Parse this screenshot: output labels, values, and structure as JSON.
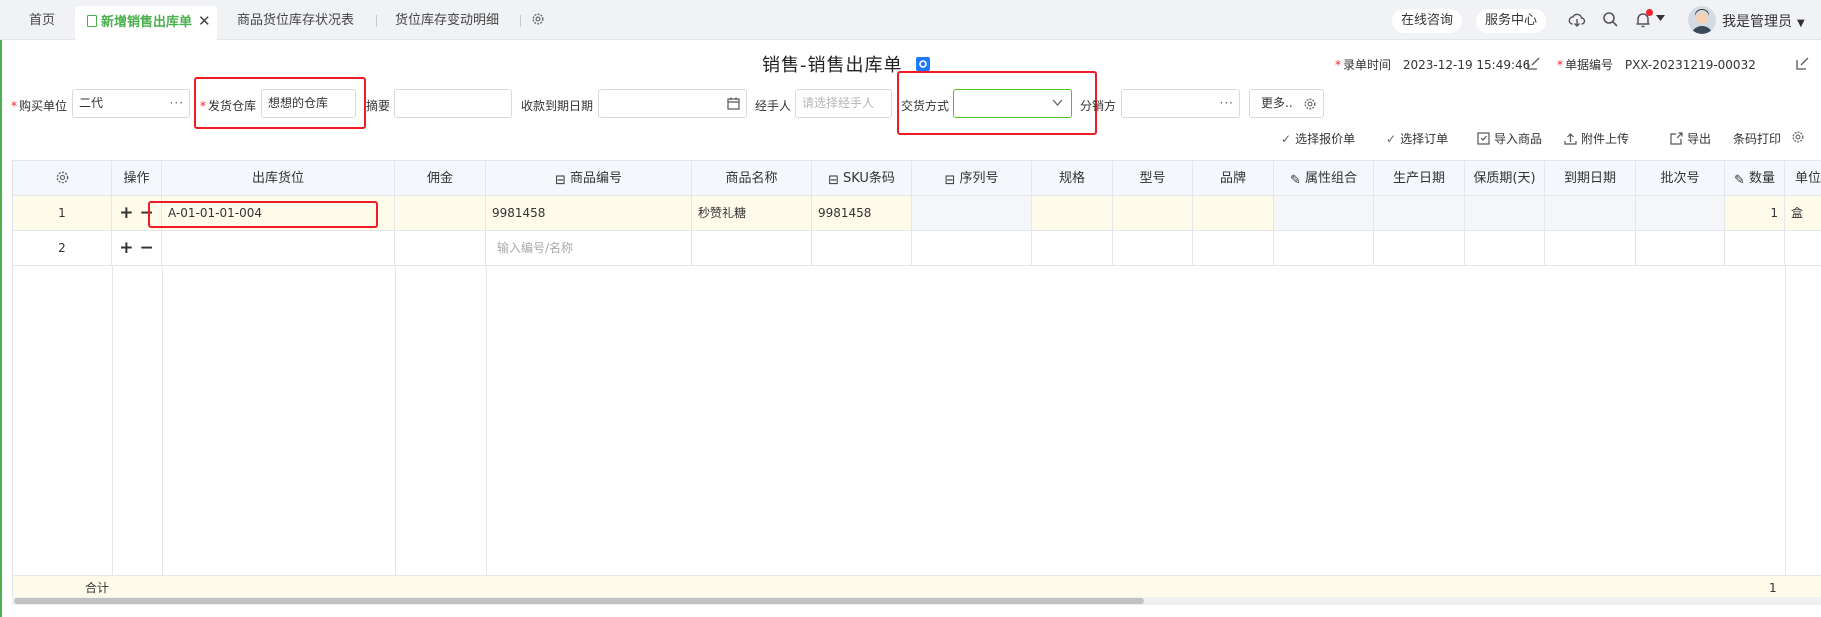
{
  "tabs": [
    {
      "label": "首页"
    },
    {
      "label": "新增销售出库单"
    },
    {
      "label": "商品货位库存状况表"
    },
    {
      "label": "货位库存变动明细"
    }
  ],
  "topbar": {
    "online_consult": "在线咨询",
    "service_center": "服务中心",
    "username": "我是管理员"
  },
  "header": {
    "title": "销售-销售出库单",
    "entry_time_label": "录单时间",
    "entry_time": "2023-12-19 15:49:46",
    "doc_no_label": "单据编号",
    "doc_no": "PXX-20231219-00032"
  },
  "form": {
    "buyer_label": "购买单位",
    "buyer_value": "二代",
    "warehouse_label": "发货仓库",
    "warehouse_value": "想想的仓库",
    "summary_label": "摘要",
    "due_date_label": "收款到期日期",
    "handler_label": "经手人",
    "handler_placeholder": "请选择经手人",
    "delivery_label": "交货方式",
    "distributor_label": "分销方",
    "more_label": "更多.."
  },
  "toolbar": {
    "select_quote": "选择报价单",
    "select_order": "选择订单",
    "import_goods": "导入商品",
    "upload_attachment": "附件上传",
    "export": "导出",
    "barcode_print": "条码打印"
  },
  "table": {
    "columns": [
      "操作",
      "出库货位",
      "佣金",
      "商品编号",
      "商品名称",
      "SKU条码",
      "序列号",
      "规格",
      "型号",
      "品牌",
      "属性组合",
      "生产日期",
      "保质期(天)",
      "到期日期",
      "批次号",
      "数量",
      "单位"
    ],
    "rows": [
      {
        "no": "1",
        "location": "A-01-01-01-004",
        "code": "9981458",
        "name": "秒赞礼糖",
        "sku": "9981458",
        "qty": "1",
        "unit": "盒"
      },
      {
        "no": "2",
        "code_placeholder": "输入编号/名称"
      }
    ],
    "total_label": "合计",
    "total_qty": "1"
  },
  "colors": {
    "accent": "#4caf50",
    "highlight_box": "#ee1c25",
    "row_highlight": "#fffbeb",
    "header_bg": "#f4f7fb"
  }
}
